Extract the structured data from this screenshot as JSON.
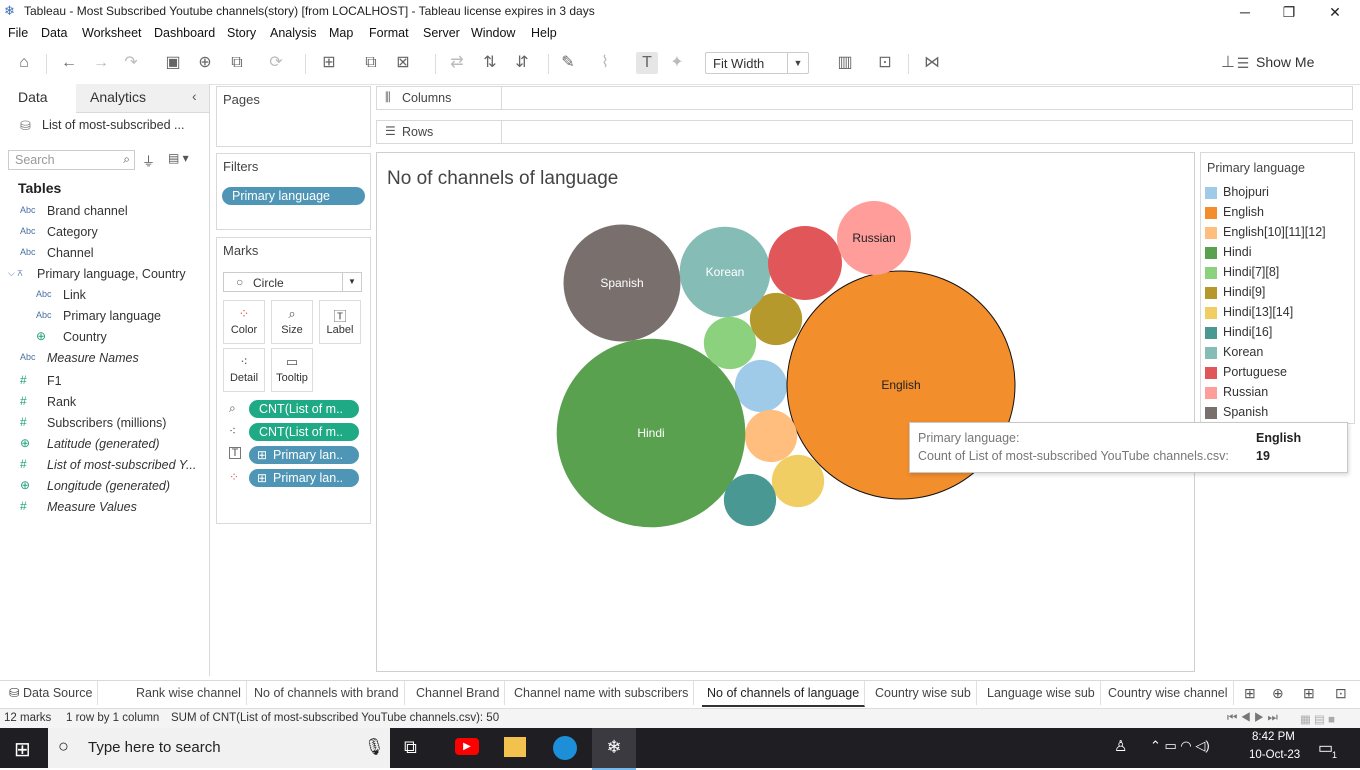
{
  "window": {
    "title": "Tableau - Most Subscribed Youtube channels(story) [from LOCALHOST] - Tableau license expires in 3 days",
    "minimize": "─",
    "maximize": "❐",
    "close": "✕"
  },
  "menu": [
    "File",
    "Data",
    "Worksheet",
    "Dashboard",
    "Story",
    "Analysis",
    "Map",
    "Format",
    "Server",
    "Window",
    "Help"
  ],
  "toolbar": {
    "fit": "Fit Width",
    "show_me": "Show Me"
  },
  "data_pane": {
    "tab_data": "Data",
    "tab_analytics": "Analytics",
    "datasource": "List of most-subscribed ...",
    "search_placeholder": "Search",
    "tables_header": "Tables",
    "fields": [
      {
        "icon": "Abc",
        "name": "Brand channel"
      },
      {
        "icon": "Abc",
        "name": "Category"
      },
      {
        "icon": "Abc",
        "name": "Channel"
      },
      {
        "icon": "hier",
        "name": "Primary language, Country"
      },
      {
        "icon": "Abc",
        "name": "Link"
      },
      {
        "icon": "Abc",
        "name": "Primary language"
      },
      {
        "icon": "globe",
        "name": "Country"
      },
      {
        "icon": "Abc",
        "name": "Measure Names"
      },
      {
        "icon": "#",
        "name": "F1"
      },
      {
        "icon": "#",
        "name": "Rank"
      },
      {
        "icon": "#",
        "name": "Subscribers (millions)"
      },
      {
        "icon": "globe",
        "name": "Latitude (generated)"
      },
      {
        "icon": "#",
        "name": "List of most-subscribed Y..."
      },
      {
        "icon": "globe",
        "name": "Longitude (generated)"
      },
      {
        "icon": "#",
        "name": "Measure Values"
      }
    ]
  },
  "pages": {
    "title": "Pages"
  },
  "filters": {
    "title": "Filters",
    "pill": "Primary language"
  },
  "marks": {
    "title": "Marks",
    "type": "Circle",
    "buttons": [
      "Color",
      "Size",
      "Label",
      "Detail",
      "Tooltip"
    ],
    "pills": [
      "CNT(List of m..",
      "CNT(List of m..",
      "Primary lan..",
      "Primary lan.."
    ]
  },
  "shelves": {
    "columns": "Columns",
    "rows": "Rows"
  },
  "view": {
    "title": "No of channels of language"
  },
  "chart_data": {
    "type": "packed-bubble",
    "title": "No of channels of language",
    "legend_title": "Primary language",
    "legend_placement": "right",
    "categories": [
      "Bhojpuri",
      "English",
      "English[10][11][12]",
      "Hindi",
      "Hindi[7][8]",
      "Hindi[9]",
      "Hindi[13][14]",
      "Hindi[16]",
      "Korean",
      "Portuguese",
      "Russian",
      "Spanish"
    ],
    "colors": [
      "#a0cbe8",
      "#f28e2b",
      "#ffbe7d",
      "#59a14f",
      "#8cd17d",
      "#b6992d",
      "#f1ce63",
      "#499894",
      "#86bcb6",
      "#e15759",
      "#ff9d9a",
      "#79706e"
    ],
    "labels": [
      "Spanish",
      "Korean",
      "Russian",
      "Hindi",
      "English"
    ],
    "values": [
      1,
      19,
      1,
      13,
      1,
      1,
      1,
      1,
      3,
      2,
      2,
      5
    ]
  },
  "tooltip": {
    "label1": "Primary language:",
    "value1": "English",
    "label2": "Count of List of most-subscribed YouTube channels.csv:",
    "value2": "19"
  },
  "sheet_tabs": [
    "Data Source",
    "Rank wise channel",
    "No of channels with brand",
    "Channel Brand",
    "Channel name with subscribers",
    "No of channels of language",
    "Country wise sub",
    "Language wise sub",
    "Country wise channel"
  ],
  "status": {
    "marks": "12 marks",
    "rows": "1 row by 1 column",
    "sum": "SUM of CNT(List of most-subscribed YouTube channels.csv): 50"
  },
  "taskbar": {
    "search": "Type here to search",
    "time": "8:42 PM",
    "date": "10-Oct-23",
    "notif": "1"
  }
}
